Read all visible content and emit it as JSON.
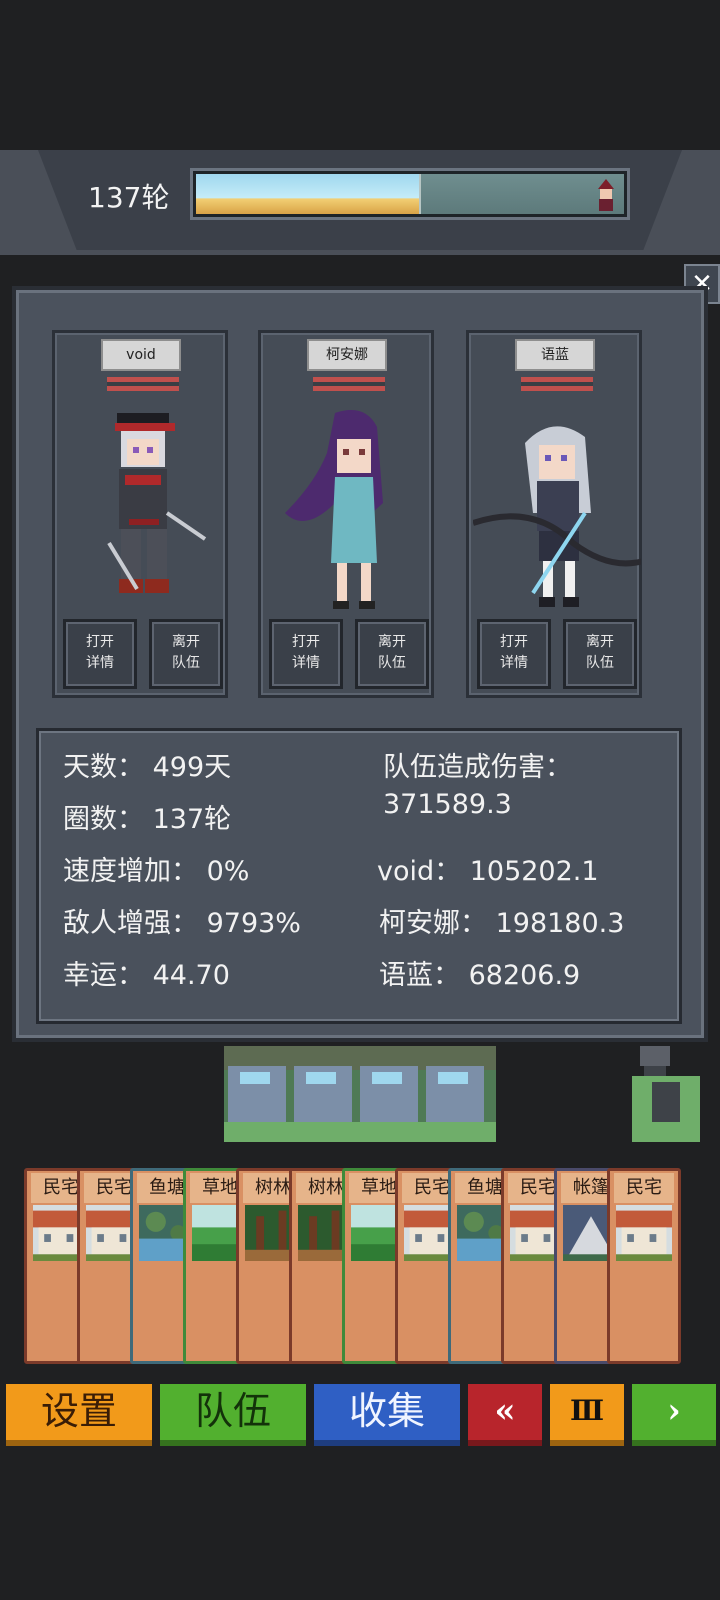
{
  "header": {
    "round_label": "137轮",
    "progress": 0.52
  },
  "close_icon": "close-icon",
  "heroes": [
    {
      "name": "void",
      "open_label": "打开\n详情",
      "leave_label": "离开\n队伍"
    },
    {
      "name": "柯安娜",
      "open_label": "打开\n详情",
      "leave_label": "离开\n队伍"
    },
    {
      "name": "语蓝",
      "open_label": "打开\n详情",
      "leave_label": "离开\n队伍"
    }
  ],
  "stats": {
    "days": "天数： 499天",
    "rounds": "圈数： 137轮",
    "speed": "速度增加： 0%",
    "enemy": "敌人增强： 9793%",
    "luck": "幸运： 44.70",
    "damage_title": "队伍造成伤害：",
    "damage_total": "371589.3",
    "damage_void": "void： 105202.1",
    "damage_keanna": "柯安娜： 198180.3",
    "damage_yulan": "语蓝： 68206.9"
  },
  "cards": [
    {
      "name": "民宅",
      "type": "house"
    },
    {
      "name": "民宅",
      "type": "house"
    },
    {
      "name": "鱼塘",
      "type": "pond"
    },
    {
      "name": "草地",
      "type": "grass"
    },
    {
      "name": "树林",
      "type": "forest"
    },
    {
      "name": "树林",
      "type": "forest"
    },
    {
      "name": "草地",
      "type": "grass"
    },
    {
      "name": "民宅",
      "type": "house"
    },
    {
      "name": "鱼塘",
      "type": "pond"
    },
    {
      "name": "民宅",
      "type": "house"
    },
    {
      "name": "帐篷",
      "type": "tent"
    },
    {
      "name": "民宅",
      "type": "house"
    }
  ],
  "menu": {
    "settings": "设置",
    "team": "队伍",
    "collect": "收集",
    "rewind": "«",
    "pause": "Ⅲ",
    "play": "›"
  },
  "colors": {
    "settings": "#f29a1a",
    "team": "#52b02f",
    "collect": "#2f5fc4",
    "rewind": "#b8252c",
    "pause": "#f29a1a",
    "play": "#52b02f"
  }
}
